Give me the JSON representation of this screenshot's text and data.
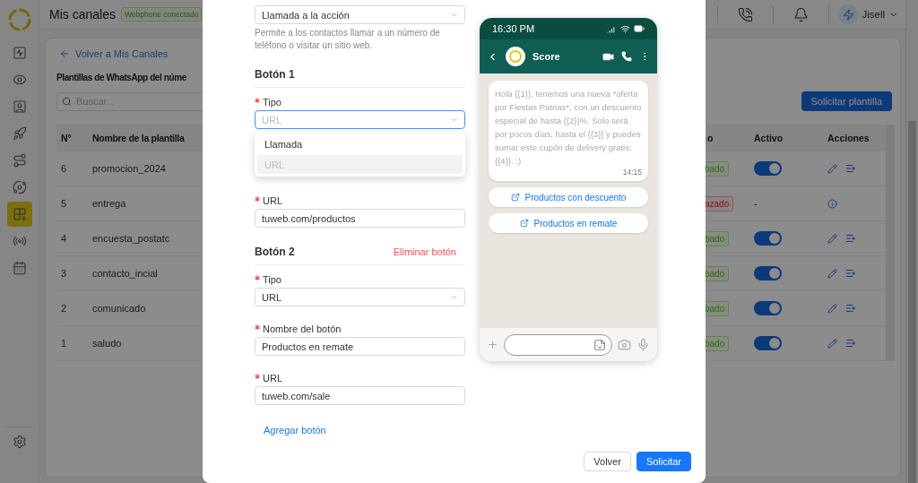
{
  "sidebar": {
    "items": [
      {
        "selected": false
      },
      {
        "selected": false
      },
      {
        "selected": false
      },
      {
        "selected": false
      },
      {
        "selected": false
      },
      {
        "selected": false
      },
      {
        "selected": true
      },
      {
        "selected": false
      },
      {
        "selected": false
      }
    ]
  },
  "header": {
    "title": "Mis canales",
    "badge": "Webphone conectado",
    "user": "Jisell"
  },
  "page": {
    "back_link": "Volver a Mis Canales",
    "title": "Plantillas de WhatsApp del núme",
    "search": {
      "placeholder": "Buscar..."
    },
    "request_button": "Solicitar plantilla"
  },
  "table": {
    "columns": [
      "N°",
      "Nombre de la plantilla",
      "o",
      "Activo",
      "Acciones"
    ],
    "rows": [
      {
        "number": "6",
        "name": "promocion_2024",
        "status": "bado",
        "kind": "approved",
        "active": true
      },
      {
        "number": "5",
        "name": "entrega",
        "status": "azado",
        "kind": "rejected",
        "active_text": "-"
      },
      {
        "number": "4",
        "name": "encuesta_postatc",
        "status": "bado",
        "kind": "approved",
        "active": true
      },
      {
        "number": "3",
        "name": "contacto_incial",
        "status": "bado",
        "kind": "approved",
        "active": true
      },
      {
        "number": "2",
        "name": "comunicado",
        "status": "bado",
        "kind": "approved",
        "active": true
      },
      {
        "number": "1",
        "name": "saludo",
        "status": "bado",
        "kind": "approved",
        "active": true
      }
    ]
  },
  "modal": {
    "category_select": {
      "value": "Llamada a la acción"
    },
    "help": "Permite a los contactos llamar a un número de teléfono o visitar un sitio web.",
    "buttons": [
      {
        "title": "Botón 1",
        "fields": [
          {
            "label": "Tipo",
            "required": true,
            "kind": "select",
            "value": "URL",
            "open": true,
            "options": [
              {
                "label": "Llamada",
                "selected": false
              },
              {
                "label": "URL",
                "selected": true
              }
            ]
          },
          {
            "label": "URL",
            "required": true,
            "kind": "input",
            "value": "tuweb.com/productos"
          }
        ]
      },
      {
        "title": "Botón 2",
        "remove": "Eliminar botón",
        "fields": [
          {
            "label": "Tipo",
            "required": true,
            "kind": "select",
            "value": "URL",
            "open": false
          },
          {
            "label": "Nombre del botón",
            "required": true,
            "kind": "input",
            "value": "Productos en remate"
          },
          {
            "label": "URL",
            "required": true,
            "kind": "input",
            "value": "tuweb.com/sale"
          }
        ]
      }
    ],
    "add_button": "Agregar botón",
    "footer": [
      {
        "label": "Volver",
        "kind": "secondary"
      },
      {
        "label": "Solicitar",
        "kind": "primary"
      }
    ]
  },
  "phone": {
    "time": "16:30 PM",
    "contact": "Score",
    "message": "Hola {{1}}, tenemos una nueva *oferta por Fiestas Patrias*, con un descuento especial de hasta {{2}}%. Solo será por pocos días, hasta el {{3}} y puedes sumar este cupón de delivery gratis: {{4}}. :)",
    "message_time": "14:15",
    "buttons": [
      "Productos con descuento",
      "Productos en remate"
    ]
  }
}
